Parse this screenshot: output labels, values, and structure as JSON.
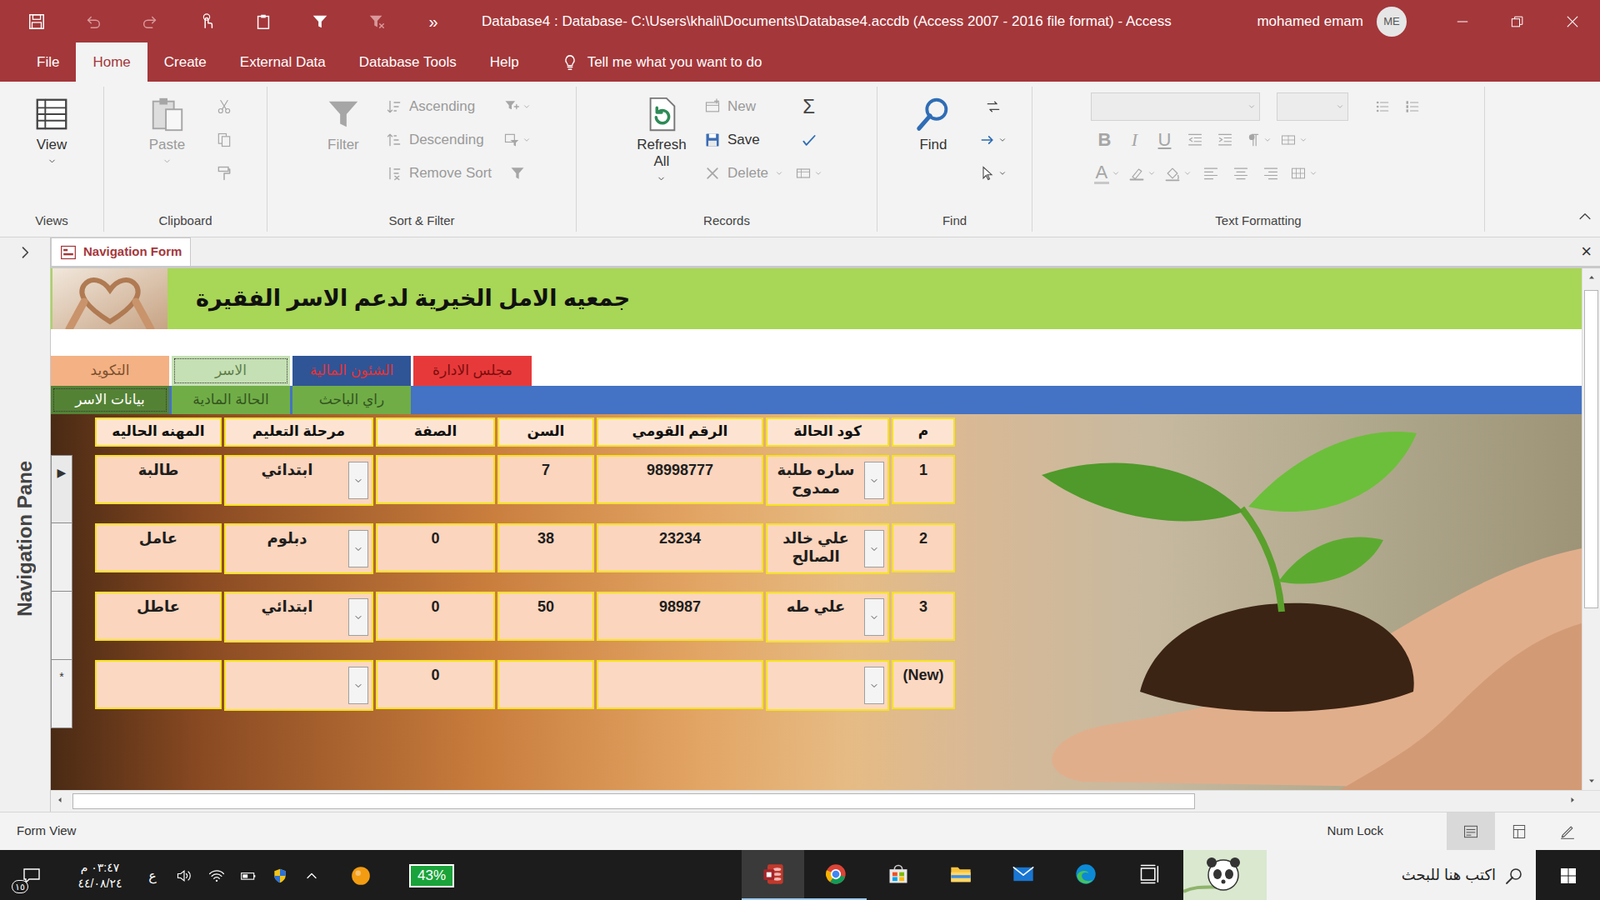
{
  "window": {
    "title": "Database4 : Database- C:\\Users\\khali\\Documents\\Database4.accdb (Access 2007 - 2016 file format)  -  Access",
    "user": "mohamed emam",
    "initials": "ME"
  },
  "quick_access": {
    "items": [
      {
        "kind": "save",
        "disabled": false
      },
      {
        "kind": "undo",
        "disabled": true
      },
      {
        "kind": "redo",
        "disabled": true
      },
      {
        "kind": "touch",
        "disabled": false
      },
      {
        "kind": "clipboard",
        "disabled": false
      },
      {
        "kind": "filter",
        "disabled": false
      },
      {
        "kind": "filter-clear",
        "disabled": true
      }
    ],
    "more": "»"
  },
  "menu": {
    "tabs": [
      {
        "label": "File",
        "selected": false
      },
      {
        "label": "Home",
        "selected": true
      },
      {
        "label": "Create",
        "selected": false
      },
      {
        "label": "External Data",
        "selected": false
      },
      {
        "label": "Database Tools",
        "selected": false
      },
      {
        "label": "Help",
        "selected": false
      }
    ],
    "tell_me": "Tell me what you want to do"
  },
  "ribbon": {
    "groups": [
      {
        "label": "Views",
        "large": [
          {
            "label": "View",
            "kind": "view",
            "disabled": false,
            "dropdown": true
          }
        ],
        "small": [],
        "icons": []
      },
      {
        "label": "Clipboard",
        "large": [
          {
            "label": "Paste",
            "kind": "paste",
            "disabled": true,
            "dropdown": true
          }
        ],
        "small": [],
        "icons": [
          {
            "kind": "cut",
            "disabled": true,
            "dropdown": false
          },
          {
            "kind": "copy",
            "disabled": true,
            "dropdown": false
          },
          {
            "kind": "painter",
            "disabled": true,
            "dropdown": false
          }
        ]
      },
      {
        "label": "Sort & Filter",
        "large": [
          {
            "label": "Filter",
            "kind": "filter",
            "disabled": true,
            "dropdown": false
          }
        ],
        "small": [
          {
            "label": "Ascending",
            "kind": "ascending",
            "disabled": true,
            "dropdown": false
          },
          {
            "label": "Descending",
            "kind": "descending",
            "disabled": true,
            "dropdown": false
          },
          {
            "label": "Remove Sort",
            "kind": "remove-sort",
            "disabled": true,
            "dropdown": false
          }
        ],
        "icons": [
          {
            "kind": "selection",
            "disabled": true,
            "dropdown": true
          },
          {
            "kind": "advanced",
            "disabled": true,
            "dropdown": true
          },
          {
            "kind": "filter",
            "disabled": true,
            "dropdown": false
          }
        ]
      },
      {
        "label": "Records",
        "large": [
          {
            "label": "Refresh All",
            "kind": "refresh",
            "disabled": false,
            "dropdown": true
          }
        ],
        "small": [
          {
            "label": "New",
            "kind": "new",
            "disabled": true,
            "dropdown": false
          },
          {
            "label": "Save",
            "kind": "save-record",
            "disabled": false,
            "dropdown": false
          },
          {
            "label": "Delete",
            "kind": "delete",
            "disabled": true,
            "dropdown": true
          }
        ],
        "icons": [
          {
            "kind": "totals",
            "glyph": "Σ",
            "disabled": false,
            "dropdown": false
          },
          {
            "kind": "spelling",
            "disabled": false,
            "dropdown": false
          },
          {
            "kind": "more",
            "disabled": true,
            "dropdown": true
          }
        ]
      },
      {
        "label": "Find",
        "large": [
          {
            "label": "Find",
            "kind": "find",
            "disabled": false,
            "dropdown": false
          }
        ],
        "small": [],
        "icons": [
          {
            "kind": "replace",
            "disabled": false,
            "dropdown": false
          },
          {
            "kind": "goto",
            "disabled": false,
            "dropdown": true
          },
          {
            "kind": "select",
            "disabled": false,
            "dropdown": true
          }
        ]
      },
      {
        "label": "Text Formatting",
        "font": {
          "disabled": true
        },
        "size": {
          "disabled": true
        },
        "rows": [
          [
            {
              "kind": "bullets",
              "disabled": true,
              "dropdown": false
            },
            {
              "kind": "numbering",
              "disabled": true,
              "dropdown": false
            }
          ],
          [
            {
              "kind": "bold",
              "glyph": "B",
              "disabled": true,
              "dropdown": false
            },
            {
              "kind": "italic",
              "glyph": "I",
              "disabled": true,
              "dropdown": false
            },
            {
              "kind": "underline",
              "glyph": "U",
              "disabled": true,
              "dropdown": false
            },
            {
              "kind": "indent-less",
              "disabled": true,
              "dropdown": false
            },
            {
              "kind": "indent-more",
              "disabled": true,
              "dropdown": false
            },
            {
              "kind": "rtl",
              "disabled": true,
              "dropdown": true
            },
            {
              "kind": "gridlines",
              "disabled": true,
              "dropdown": true
            }
          ],
          [
            {
              "kind": "font-color",
              "glyph": "A",
              "disabled": true,
              "dropdown": true
            },
            {
              "kind": "highlight",
              "disabled": true,
              "dropdown": true
            },
            {
              "kind": "fill",
              "disabled": true,
              "dropdown": true
            },
            {
              "kind": "align-left",
              "disabled": true,
              "dropdown": false
            },
            {
              "kind": "align-center",
              "disabled": true,
              "dropdown": false
            },
            {
              "kind": "align-right",
              "disabled": true,
              "dropdown": false
            },
            {
              "kind": "alt-fill",
              "disabled": true,
              "dropdown": true
            }
          ]
        ]
      }
    ]
  },
  "nav_pane": {
    "label": "Navigation Pane",
    "expanded": false
  },
  "form_tab": {
    "label": "Navigation Form",
    "selected": true,
    "close": "×"
  },
  "form": {
    "title": "جمعيه الامل الخيرية لدعم الاسر الفقيرة",
    "main_tabs": [
      {
        "label": "التكويد",
        "selected": false,
        "color": "#f4b183",
        "text_color": "#7a5030"
      },
      {
        "label": "الاسر",
        "selected": true,
        "color": "#c5e0b4",
        "text_color": "#5f7f4c"
      },
      {
        "label": "الشئون المالية",
        "selected": false,
        "color": "#2f5597",
        "text_color": "#e83232"
      },
      {
        "label": "مجلس الادارة",
        "selected": false,
        "color": "#e8393a",
        "text_color": "#7a0e0e"
      }
    ],
    "sub_tabs": [
      {
        "label": "بيانات الاسر",
        "selected": true,
        "color": "#548235",
        "text_color": "#ffffff"
      },
      {
        "label": "الحالة المادية",
        "selected": false,
        "color": "#70ad47",
        "text_color": "#34551f"
      },
      {
        "label": "راي الباحث",
        "selected": false,
        "color": "#70ad47",
        "text_color": "#34551f"
      }
    ]
  },
  "table": {
    "columns": [
      {
        "label": "م",
        "kind": "text"
      },
      {
        "label": "كود الحالة",
        "kind": "combo"
      },
      {
        "label": "الرقم القومي",
        "kind": "text"
      },
      {
        "label": "السن",
        "kind": "text"
      },
      {
        "label": "الصفة",
        "kind": "text"
      },
      {
        "label": "مرحلة التعليم",
        "kind": "combo"
      },
      {
        "label": "المهنه الحاليه",
        "kind": "text"
      }
    ],
    "rows": [
      {
        "selector": "▶",
        "current": true,
        "new": false,
        "cells": [
          "1",
          "ساره طلبة ممدوح",
          "98998777",
          "7",
          "",
          "ابتدائي",
          "طالبة"
        ]
      },
      {
        "selector": "",
        "current": false,
        "new": false,
        "cells": [
          "2",
          "علي خالد الصالح",
          "23234",
          "38",
          "0",
          "دبلوم",
          "عامل"
        ]
      },
      {
        "selector": "",
        "current": false,
        "new": false,
        "cells": [
          "3",
          "علي طه",
          "98987",
          "50",
          "0",
          "ابتدائي",
          "عاطل"
        ]
      },
      {
        "selector": "*",
        "current": false,
        "new": true,
        "cells": [
          "(New)",
          "",
          "",
          "",
          "0",
          "",
          ""
        ]
      }
    ]
  },
  "status_bar": {
    "view": "Form View",
    "num_lock": "Num Lock",
    "views": [
      {
        "kind": "form-view",
        "selected": true
      },
      {
        "kind": "layout-view",
        "selected": false
      },
      {
        "kind": "design-view",
        "selected": false
      }
    ]
  },
  "taskbar": {
    "notifications": "١٥",
    "time": "٠٣:٤٧ م",
    "date": "٤٤/٠٨/٢٤",
    "language": "ع",
    "tray": [
      {
        "kind": "volume"
      },
      {
        "kind": "wifi"
      },
      {
        "kind": "battery"
      },
      {
        "kind": "shield"
      },
      {
        "kind": "caret-up"
      },
      {
        "kind": "orange"
      }
    ],
    "battery_widget": "43%",
    "apps": [
      {
        "kind": "access",
        "running": true,
        "active": true
      },
      {
        "kind": "chrome",
        "running": true,
        "active": false
      },
      {
        "kind": "store",
        "running": false,
        "active": false
      },
      {
        "kind": "explorer",
        "running": false,
        "active": false
      },
      {
        "kind": "mail",
        "running": false,
        "active": false
      },
      {
        "kind": "edge",
        "running": false,
        "active": false
      },
      {
        "kind": "taskview",
        "running": false,
        "active": false
      }
    ],
    "search": {
      "placeholder": "اكتب هنا للبحث"
    }
  }
}
